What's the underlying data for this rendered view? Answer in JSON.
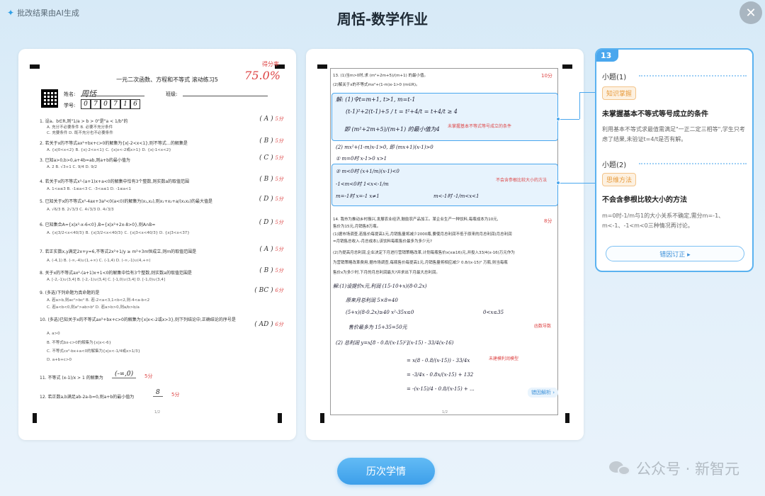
{
  "header": {
    "ai_tag": "批改结果由AI生成",
    "title": "周恬-数学作业",
    "close_icon": "close-icon"
  },
  "left_paper": {
    "title": "一元二次函数、方程和不等式 滚动练习5",
    "score_label": "得分率",
    "score_value": "75.0%",
    "name_label": "姓名:",
    "name_value": "周恬",
    "class_label": "班级:",
    "id_label": "学号:",
    "id_digits": [
      "0",
      "7",
      "0",
      "7",
      "1",
      "6"
    ],
    "questions": [
      {
        "text": "1. 设a、b∈R,则\"1/a > b > 0\"是\"a < 1/b\"的",
        "ans": "A",
        "pts": "5分"
      },
      {
        "text": "2. 若关于x的不等式ax²+bx+c>0的解集为{x|-2<x<1},则不等式…的解集是",
        "ans": "B",
        "pts": "5分"
      },
      {
        "text": "3. 已知a>0,b>0,a+4b=ab,则a+b的最小值为",
        "ans": "C",
        "pts": "5分"
      },
      {
        "text": "4. 若关于x的不等式x²-(a+1)x+a<0的解集中恰有3个整数,则实数a的取值范围",
        "ans": "B",
        "pts": "5分"
      },
      {
        "text": "5. 已知关于x的不等式x²-4ax+3a²<0(a<0)的解集为(x₁,x₂),则x₁+x₂+a/(x₁x₂)的最大值是",
        "ans": "D",
        "pts": "5分"
      },
      {
        "text": "6. 已知集合A={x|x²-x-6<0},B={x|x²+2x-8>0},则A∩B=",
        "ans": "D",
        "pts": "5分"
      },
      {
        "text": "7. 若正实数x,y满足2x+y=6,不等式2x²+1/y ≥ m²+3m恒成立,则m的取值范围是",
        "ans": "A",
        "pts": "5分"
      },
      {
        "text": "8. 关于x的不等式ax²-(a+1)x+1<0的解集中恰有3个整数,则实数a的取值范围是",
        "ans": "B",
        "pts": "5分"
      },
      {
        "text": "9. (多选)下列命题为真命题的是",
        "ans": "BC",
        "pts": "6分"
      },
      {
        "text": "10. (多选)已知关于x的不等式ax²+bx+c>0的解集为{x|x<-2或x>3},则下列结论中,正确结论的序号是",
        "ans": "AD",
        "pts": "6分"
      }
    ],
    "sub_lines": [
      "A. 充分不必要条件   B. 必要不充分条件",
      "C. 充要条件   D. 既不充分也不必要条件",
      "A. {x|0<x<2}   B. {x|-2<x<1}   C. {x|x<-2或x>1}   D. {x|-1<x<2}",
      "A. 2   B. √3+1   C. 9/4   D. 9/2",
      "A. 1<a≤3   B. -1≤a<3   C. -3<a≤1   D. -1≤a<1",
      "A. √6/3   B. 2√3/3   C. 4√3/3   D. 4√3/3",
      "A. {x|3/2<x<40/3}   B. {x|3/2<x<40/3}   C. {x|3<x<40/3}   D. {x|3<x<37}",
      "A. (-4,1)   B. (-∞,-4)∪(1,+∞)   C. (-1,4)   D. (-∞,-1)∪(4,+∞)",
      "A. [-2,-1)∪(3,4]   B. [-2,-1)∪(3,4]   C. [-1,0)∪(3,4]   D. [-1,0)∪(3,4]",
      "A. 若a>b,则ac²>bc²   B. 若-2<a<3,1<b<2,则-4<a-b<2",
      "C. 若a<b<0,则a²>ab>b²   D. 若a>b>0,则a/b>b/a",
      "A. a>0",
      "B. 不等式bx-c>0的解集为{x|x<-6}",
      "C. 不等式cx²-bx+a<0的解集为{x|x<-1/4或x>1/3}",
      "D. a+b+c>0"
    ],
    "fill_11": {
      "text": "11. 不等式 (x-1)/x > 1 的解集为",
      "ans": "(-∞,0)",
      "pts": "5分"
    },
    "fill_12": {
      "text": "12. 若正数a,b满足ab-2a-b=0,则a+b的最小值为",
      "ans": "8",
      "pts": "5分"
    },
    "page_num": "1/2"
  },
  "right_paper": {
    "q13": "13. (1)当m>0时,求 (m²+2m+5)/(m+1) 的最小值。",
    "q13_pts": "10分",
    "q13_sub": "(2)解关于x的不等式mx²+(1-m)x-1>0 (m∈R)。",
    "hw_lines": [
      "解: (1)令t=m+1,  t>1,  m=t-1",
      "(t-1)²+2(t-1)+5 / t = t²+4/t = t+4/t ≥ 4",
      "即 (m²+2m+5)/(m+1) 的最小值为4",
      "(2) mx²+(1-m)x-1>0, 即 (mx+1)(x-1)>0",
      "① m=0时 x-1>0   x>1",
      "② m<0时 (x+1/m)(x-1)<0",
      "-1<m<0时  1<x<-1/m",
      "m=-1时  x=-1 x≠1",
      "m<-1时  -1/m<x<1"
    ],
    "red_notes": [
      "未掌握基本不等式等号成立的条件",
      "不会含参根比较大小的方法"
    ],
    "q14_lines": [
      "14. 我市为推动乡村振兴,发展农业经济,鼓励农产品加工。某企业生产一种饮料,每瓶成本为10元,",
      "售价为15元,月销售8万瓶。",
      "(1)据市场调查,若售价每提高1元,月销售量将减少2000瓶,要使月总利润不低于原来的月总利润(月总利润",
      "=月销售总收入-月总成本),该饮料每瓶售价最多为多少元?",
      "(2)为提高月总利润,企业决定下月进行营销策略改革,计划每瓶售价x(x≥16)元,并投入33/4(x-16)万元作为",
      "为营销策略改革费用,据市场调查,每瓶售价每提高1元,月销售量将相应减少 0.8/(x-15)² 万瓶,则当每瓶",
      "售价x为多少时,下月的月总利润最大?并求出下月最大总利润。"
    ],
    "hw_q14": [
      "解:(1)设提价x元,利润 (15-10+x)(8-0.2x)",
      "原来月总利润 5×8=40",
      "(5+x)(8-0.2x)≥40  x²-35x≤0",
      "0<x≤35",
      "售价最多为 15+35=50元",
      "(2) 总利润 y=x[8 - 0.8/(x-15)²](x-15) - 33/4(x-16)",
      "= x(8 - 0.8/(x-15)) - 33/4x",
      "= -3/4x - 0.8x/(x-15) + 132",
      "= -(x-15)/4 - 0.8/(x-15) + ..."
    ],
    "red_note_2": "函数导数",
    "red_note_3": "未建模利润模型",
    "q14_pts": "8分",
    "jump_label": "错因解析 ›",
    "page_num": "1/2"
  },
  "side_panel": {
    "q_number": "13",
    "sub1_title": "小题(1)",
    "sub1_tag": "知识掌握",
    "sub1_heading": "未掌握基本不等式等号成立的条件",
    "sub1_desc": "利用基本不等式求最值需满足\"一正二定三相等\",学生只考虑了结果,未验证t=4/t是否有解。",
    "sub2_title": "小题(2)",
    "sub2_tag": "思维方法",
    "sub2_heading": "不会含参根比较大小的方法",
    "sub2_desc": "m=0时-1/m与1的大小关系不确定,需分m=-1、m<-1、-1<m<0三种情况再讨论。",
    "correct_btn": "错因订正 ▸"
  },
  "footer": {
    "history_btn": "历次学情",
    "watermark": "公众号 · 新智元"
  },
  "colors": {
    "accent": "#4aa7ee",
    "red_mark": "#dd4444",
    "tag_orange": "#e79a3c"
  }
}
